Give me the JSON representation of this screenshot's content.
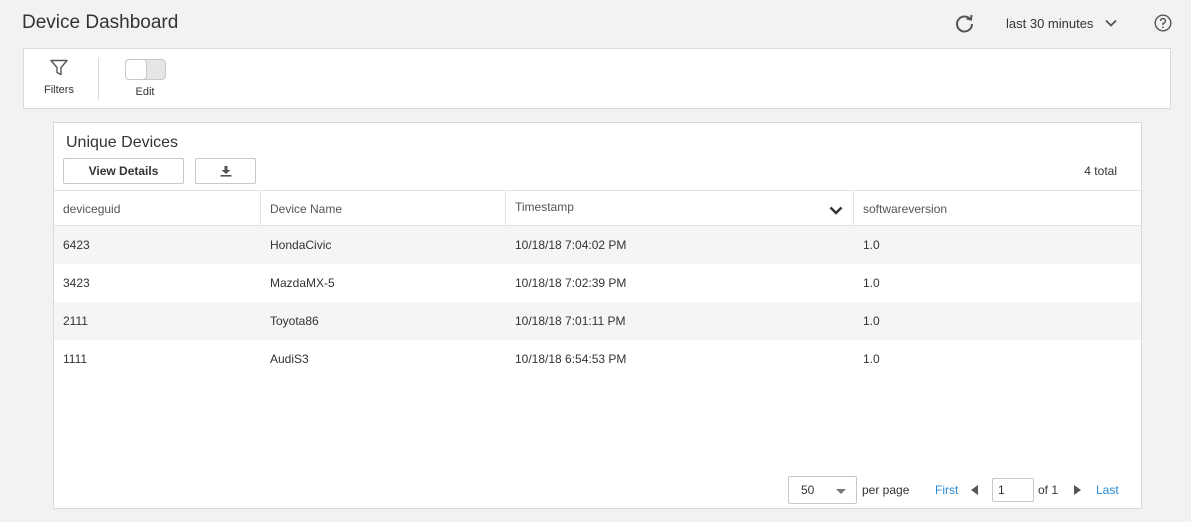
{
  "header": {
    "title": "Device Dashboard",
    "time_range": "last 30 minutes",
    "refresh_icon": "refresh-icon",
    "help_icon": "help-icon"
  },
  "toolbar": {
    "filters_label": "Filters",
    "filters_icon": "funnel-icon",
    "edit_label": "Edit",
    "edit_toggle_on": false
  },
  "panel": {
    "title": "Unique Devices",
    "view_details_label": "View Details",
    "download_icon": "download-icon",
    "total": "4 total",
    "columns": [
      "deviceguid",
      "Device Name",
      "Timestamp",
      "softwareversion"
    ],
    "rows": [
      [
        "6423",
        "HondaCivic",
        "10/18/18 7:04:02 PM",
        "1.0"
      ],
      [
        "3423",
        "MazdaMX-5",
        "10/18/18 7:02:39 PM",
        "1.0"
      ],
      [
        "2111",
        "Toyota86",
        "10/18/18 7:01:11 PM",
        "1.0"
      ],
      [
        "1111",
        "AudiS3",
        "10/18/18 6:54:53 PM",
        "1.0"
      ]
    ]
  },
  "pagination": {
    "per_page_value": "50",
    "per_page_label": "per page",
    "first_label": "First",
    "page_value": "1",
    "of_label": "of 1",
    "last_label": "Last",
    "link_color": "#2a8ad4"
  }
}
